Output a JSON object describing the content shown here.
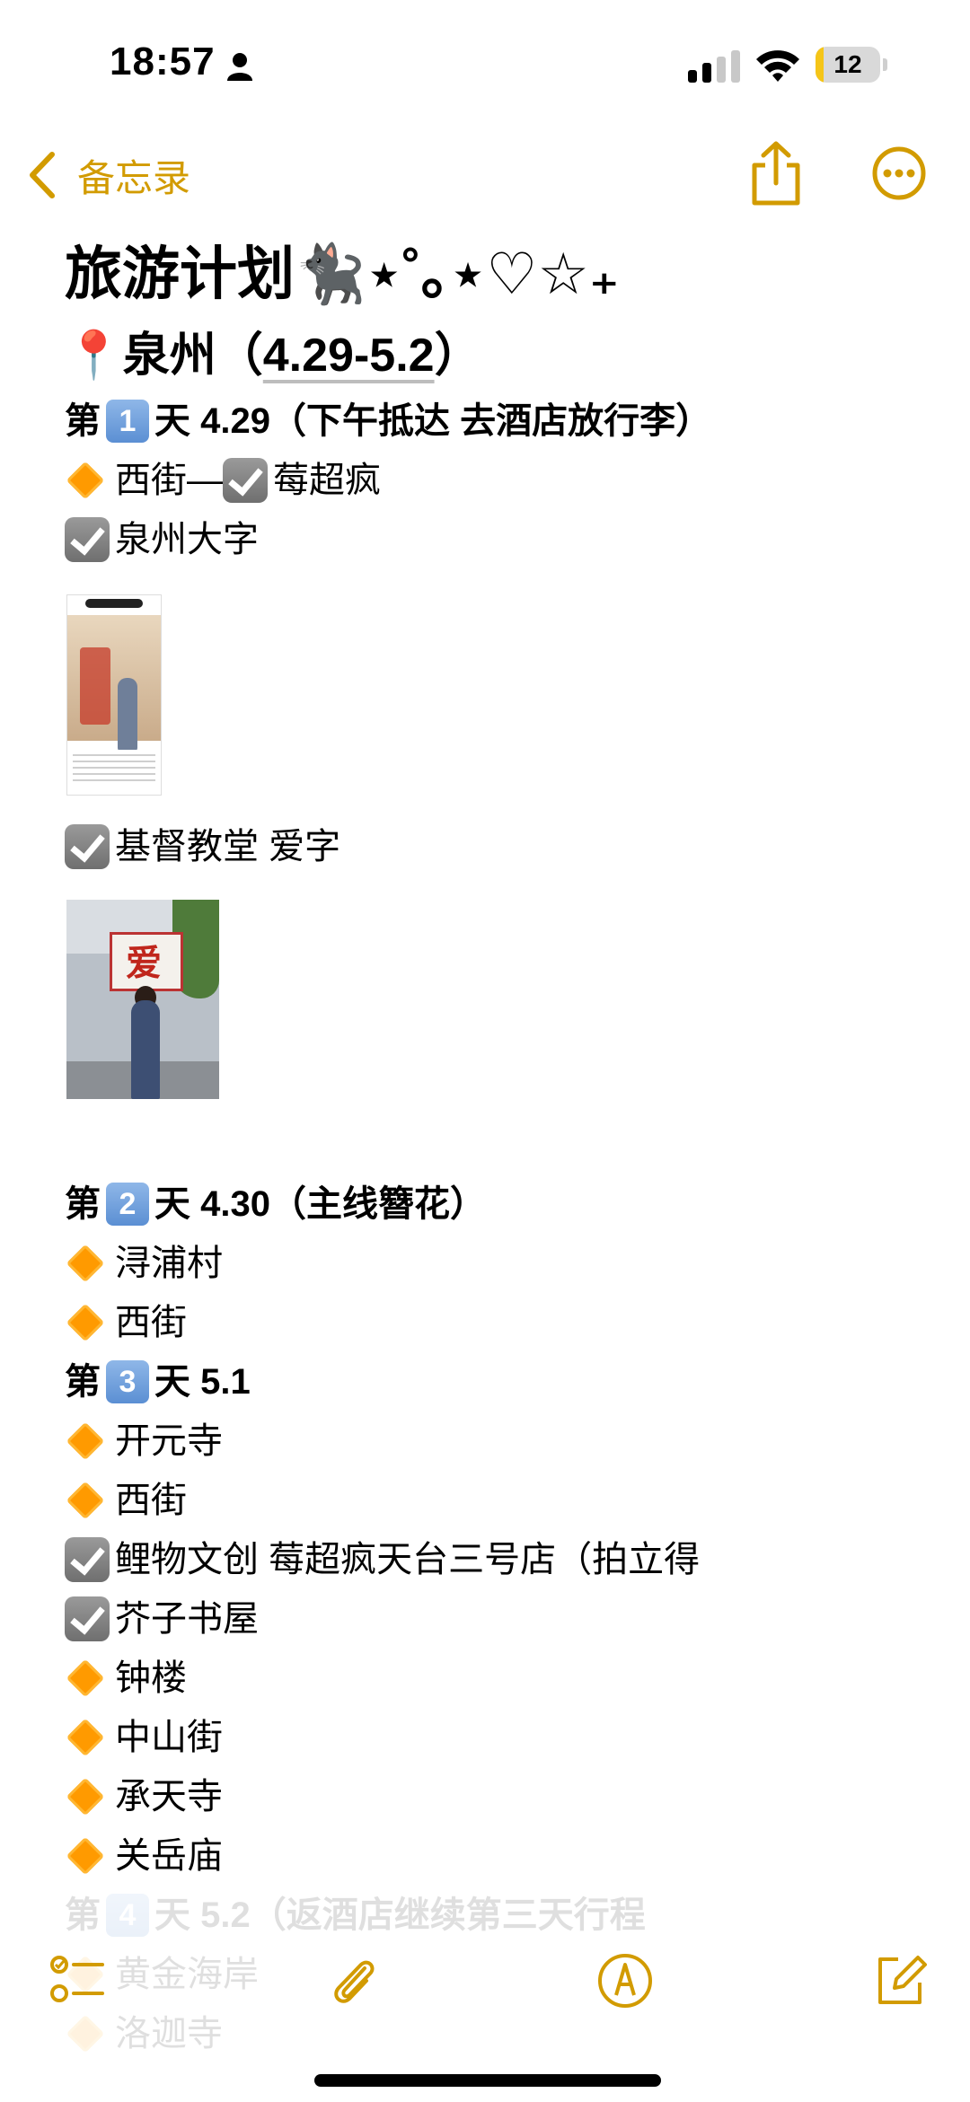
{
  "status": {
    "time": "18:57",
    "battery": "12",
    "battery_level": 0.12,
    "icons": [
      "person-icon",
      "cellular-signal-icon",
      "wifi-icon",
      "battery-icon"
    ]
  },
  "nav": {
    "back_label": "备忘录",
    "icons": [
      "chevron-left-icon",
      "share-icon",
      "more-icon"
    ],
    "accent_color": "#d29b00"
  },
  "note": {
    "title": "旅游计划🐈‍⬛⋆˚｡⋆♡☆₊",
    "location_pin": "📍",
    "location_name": "泉州（",
    "location_dates": "4.29-5.2",
    "location_close": "）",
    "day1": {
      "prefix": "第",
      "num": "1",
      "suffix": "天 4.29（下午抵达 去酒店放行李）",
      "items": [
        {
          "type": "diamond",
          "text": "西街—"
        },
        {
          "type": "check",
          "text": "莓超疯",
          "inline": true
        },
        {
          "type": "check",
          "text": "泉州大字"
        },
        {
          "type": "check",
          "text": "基督教堂 爱字"
        }
      ],
      "photo2_sign": "爱"
    },
    "day2": {
      "prefix": "第",
      "num": "2",
      "suffix": "天 4.30（主线簪花）",
      "items": [
        {
          "type": "diamond",
          "text": "浔浦村"
        },
        {
          "type": "diamond",
          "text": "西街"
        }
      ]
    },
    "day3": {
      "prefix": "第",
      "num": "3",
      "suffix": "天 5.1",
      "items": [
        {
          "type": "diamond",
          "text": "开元寺"
        },
        {
          "type": "diamond",
          "text": "西街"
        },
        {
          "type": "check",
          "text": "鲤物文创 莓超疯天台三号店（拍立得"
        },
        {
          "type": "check",
          "text": "芥子书屋"
        },
        {
          "type": "diamond",
          "text": "钟楼"
        },
        {
          "type": "diamond",
          "text": "中山街"
        },
        {
          "type": "diamond",
          "text": "承天寺"
        },
        {
          "type": "diamond",
          "text": "关岳庙"
        }
      ]
    },
    "day4": {
      "prefix": "第",
      "num": "4",
      "suffix": "天 5.2（返酒店继续第三天行程",
      "items": [
        {
          "type": "diamond",
          "text": "黄金海岸"
        },
        {
          "type": "diamond",
          "text": "洛迦寺"
        }
      ]
    }
  },
  "toolbar": {
    "icons": [
      "checklist-icon",
      "paperclip-icon",
      "markup-pen-icon",
      "compose-icon"
    ]
  }
}
